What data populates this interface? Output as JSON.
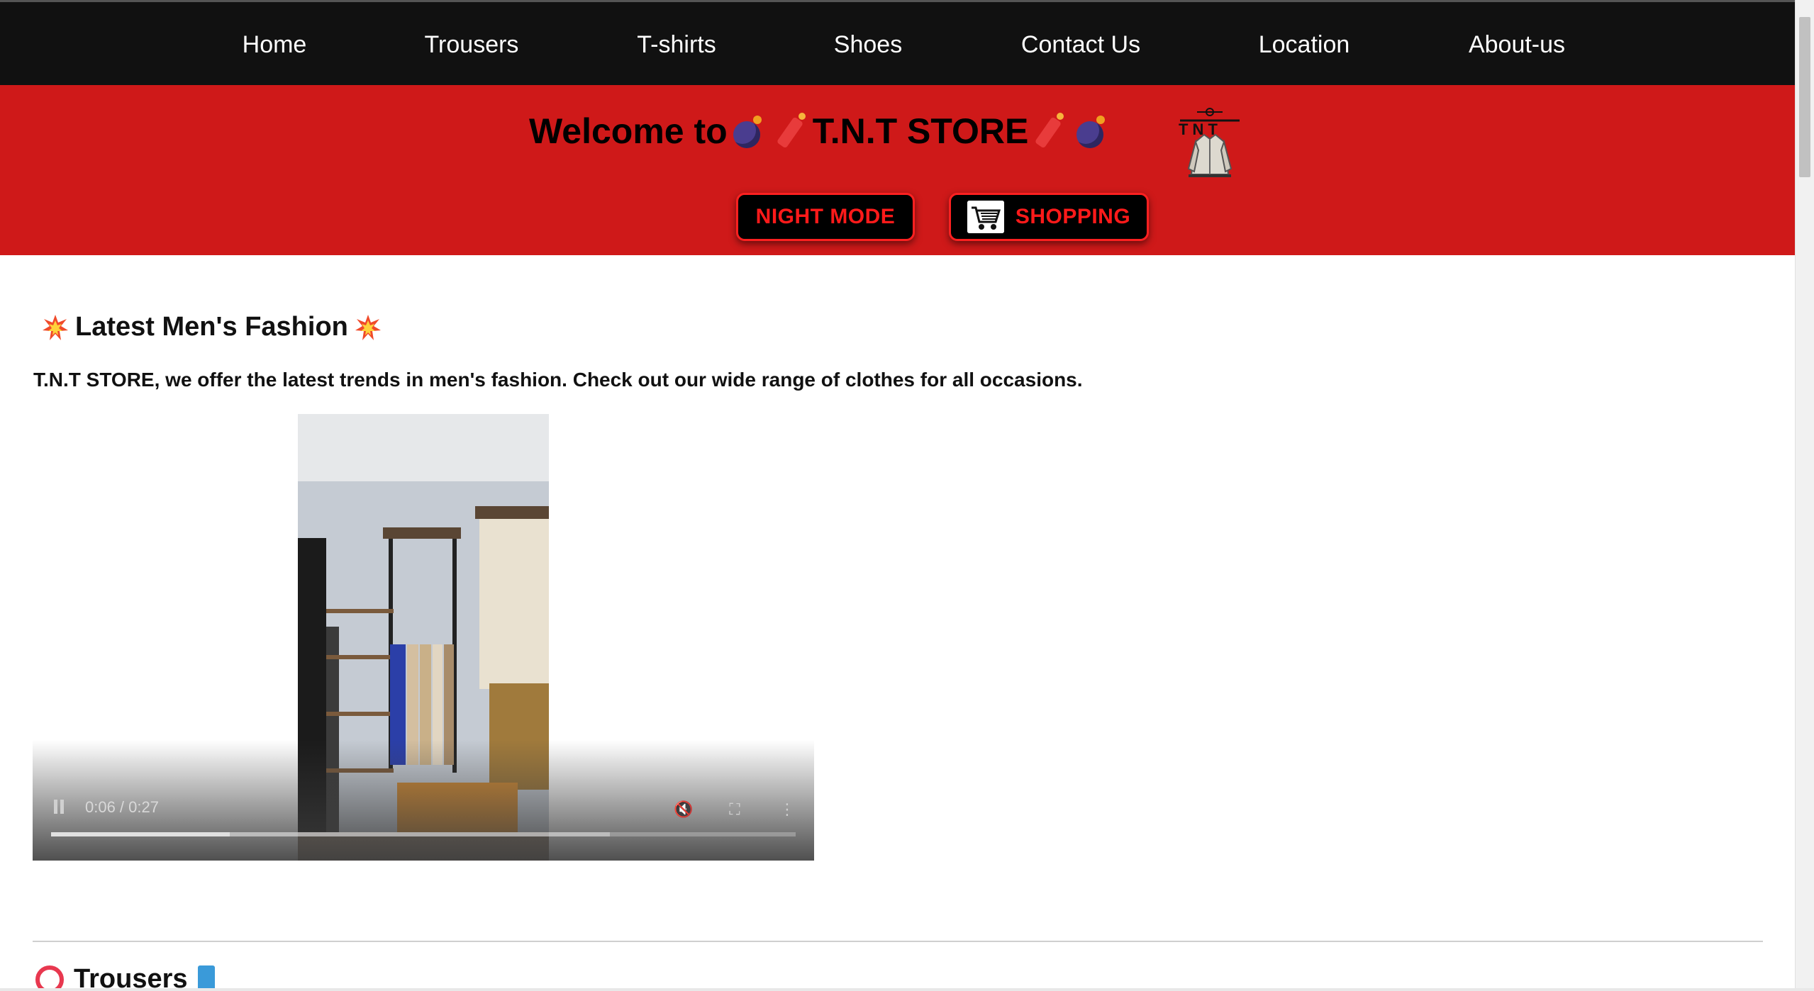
{
  "nav": {
    "items": [
      {
        "label": "Home"
      },
      {
        "label": "Trousers"
      },
      {
        "label": "T-shirts"
      },
      {
        "label": "Shoes"
      },
      {
        "label": "Contact Us"
      },
      {
        "label": "Location"
      },
      {
        "label": "About-us"
      }
    ]
  },
  "header": {
    "welcome_prefix": "Welcome to",
    "store_name": "T.N.T STORE",
    "logo_text": "T N T",
    "night_mode_label": "NIGHT MODE",
    "shopping_label": "SHOPPING",
    "background_color": "#cf1919",
    "button_text_color": "#ff1a1a"
  },
  "main": {
    "section_title": "Latest Men's Fashion",
    "intro": "T.N.T STORE, we offer the latest trends in men's fashion. Check out our wide range of clothes for all occasions.",
    "video": {
      "time": "0:06 / 0:27",
      "played_fraction": 0.24,
      "buffered_fraction": 0.75
    },
    "next_section_title": "Trousers"
  },
  "icons": {
    "welcome_left": [
      "bomb-icon",
      "dynamite-icon"
    ],
    "welcome_right": [
      "dynamite-icon",
      "bomb-icon"
    ],
    "section_title": "collision-icon",
    "next_section_left": "ring-icon",
    "next_section_right": "jeans-icon"
  }
}
